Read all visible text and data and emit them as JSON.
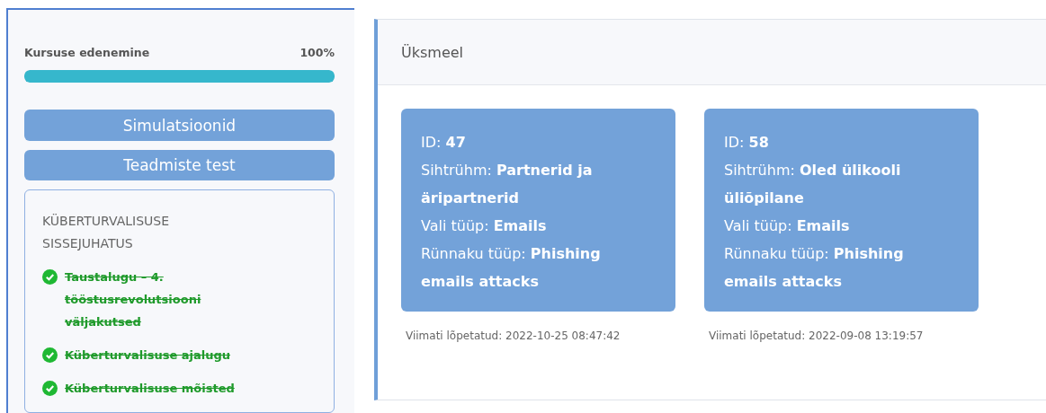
{
  "progress": {
    "label": "Kursuse edenemine",
    "percent": "100%",
    "level": 1
  },
  "buttons": [
    "Simulatsioonid",
    "Teadmiste test"
  ],
  "module": {
    "title": "KÜBERTURVALISUSE SISSEJUHATUS",
    "lessons": [
      {
        "label": "Taustalugu – 4. tööstusrevolutsiooni väljakutsed",
        "completed": true
      },
      {
        "label": "Küberturvalisuse ajalugu",
        "completed": true
      },
      {
        "label": "Küberturvalisuse mõisted",
        "completed": true
      }
    ]
  },
  "panel": {
    "title": "Üksmeel",
    "cards": [
      {
        "lines": [
          "ID: **47**",
          "Sihtrühm: **Partnerid ja äripartnerid**",
          "Vali tüüp: **Emails**",
          "Rünnaku tüüp: **Phishing emails attacks**"
        ],
        "footer": "Viimati lõpetatud: 2022-10-25 08:47:42"
      },
      {
        "lines": [
          "ID: **58**",
          "Sihtrühm: **Oled ülikooli üliõpilane**",
          "Vali tüüp: **Emails**",
          "Rünnaku tüüp: **Phishing emails attacks**"
        ],
        "footer": "Viimati lõpetatud: 2022-09-08 13:19:57"
      }
    ]
  }
}
